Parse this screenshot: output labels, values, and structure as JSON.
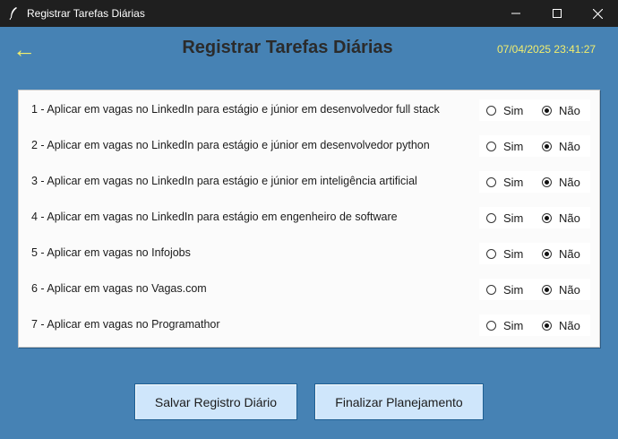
{
  "window": {
    "title": "Registrar Tarefas Diárias",
    "icon": "feather-icon"
  },
  "header": {
    "back_arrow": "←",
    "title": "Registrar Tarefas Diárias",
    "datetime": "07/04/2025 23:41:27"
  },
  "colors": {
    "background": "#4682b4",
    "accent_yellow": "#f2ee6e",
    "panel": "#fbfbfb",
    "button": "#cfe6fb"
  },
  "tasks": [
    {
      "label": "1 - Aplicar em vagas no LinkedIn para estágio e júnior em desenvolvedor full stack",
      "selected": "Não"
    },
    {
      "label": "2 - Aplicar em vagas no LinkedIn para estágio e júnior em desenvolvedor python",
      "selected": "Não"
    },
    {
      "label": "3 - Aplicar em vagas no LinkedIn para estágio e júnior em inteligência artificial",
      "selected": "Não"
    },
    {
      "label": "4 - Aplicar em vagas no LinkedIn para estágio em engenheiro de software",
      "selected": "Não"
    },
    {
      "label": "5 - Aplicar em vagas no Infojobs",
      "selected": "Não"
    },
    {
      "label": "6 - Aplicar em vagas no Vagas.com",
      "selected": "Não"
    },
    {
      "label": "7 - Aplicar em vagas no Programathor",
      "selected": "Não"
    }
  ],
  "options": {
    "yes": "Sim",
    "no": "Não"
  },
  "buttons": {
    "save": "Salvar Registro Diário",
    "finish": "Finalizar Planejamento"
  }
}
